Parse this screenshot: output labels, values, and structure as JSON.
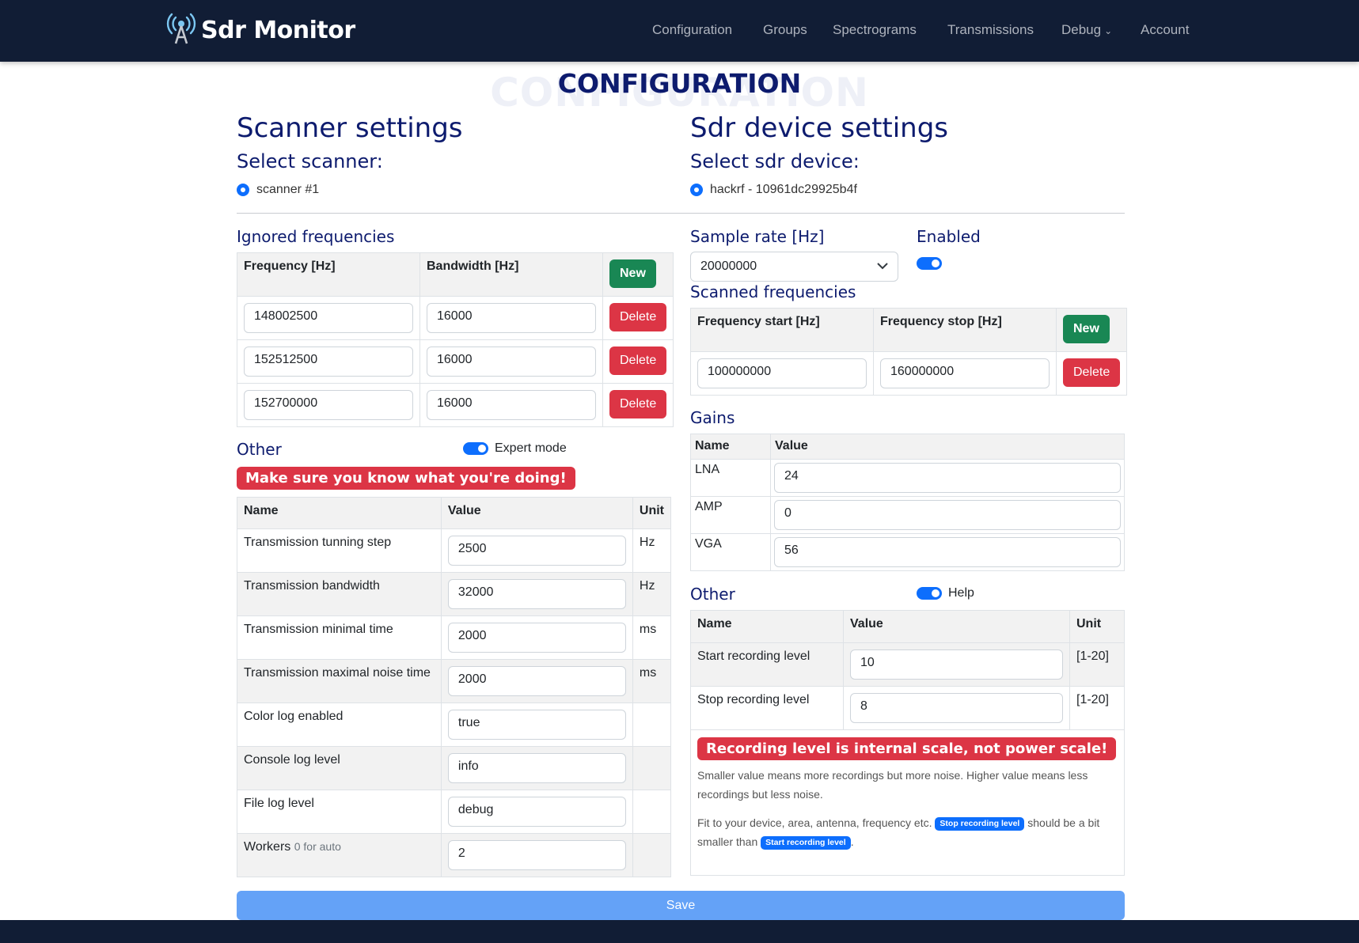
{
  "app": {
    "brand": "Sdr Monitor",
    "brand_icon": "antenna-icon"
  },
  "nav": {
    "configuration": "Configuration",
    "groups": "Groups",
    "spectrograms": "Spectrograms",
    "transmissions": "Transmissions",
    "debug": "Debug",
    "account": "Account"
  },
  "page": {
    "title": "CONFIGURATION"
  },
  "scanner": {
    "heading": "Scanner settings",
    "select_label": "Select scanner:",
    "selected": "scanner #1",
    "ignored": {
      "heading": "Ignored frequencies",
      "col_freq": "Frequency [Hz]",
      "col_bw": "Bandwidth [Hz]",
      "new": "New",
      "delete": "Delete",
      "rows": [
        {
          "freq": "148002500",
          "bw": "16000"
        },
        {
          "freq": "152512500",
          "bw": "16000"
        },
        {
          "freq": "152700000",
          "bw": "16000"
        }
      ]
    },
    "other": {
      "heading": "Other",
      "toggle_label": "Expert mode",
      "expert_on": true,
      "warning": "Make sure you know what you're doing!",
      "col_name": "Name",
      "col_value": "Value",
      "col_unit": "Unit",
      "rows": [
        {
          "name": "Transmission tunning step",
          "value": "2500",
          "unit": "Hz"
        },
        {
          "name": "Transmission bandwidth",
          "value": "32000",
          "unit": "Hz"
        },
        {
          "name": "Transmission minimal time",
          "value": "2000",
          "unit": "ms"
        },
        {
          "name": "Transmission maximal noise time",
          "value": "2000",
          "unit": "ms"
        },
        {
          "name": "Color log enabled",
          "value": "true",
          "unit": ""
        },
        {
          "name": "Console log level",
          "value": "info",
          "unit": ""
        },
        {
          "name": "File log level",
          "value": "debug",
          "unit": ""
        },
        {
          "name": "Workers",
          "hint": "0 for auto",
          "value": "2",
          "unit": ""
        }
      ]
    }
  },
  "sdr": {
    "heading": "Sdr device settings",
    "select_label": "Select sdr device:",
    "selected": "hackrf - 10961dc29925b4f",
    "sample_rate": {
      "label": "Sample rate [Hz]",
      "value": "20000000"
    },
    "enabled": {
      "label": "Enabled",
      "on": true
    },
    "scanned": {
      "heading": "Scanned frequencies",
      "col_start": "Frequency start [Hz]",
      "col_stop": "Frequency stop [Hz]",
      "new": "New",
      "delete": "Delete",
      "rows": [
        {
          "start": "100000000",
          "stop": "160000000"
        }
      ]
    },
    "gains": {
      "heading": "Gains",
      "col_name": "Name",
      "col_value": "Value",
      "rows": [
        {
          "name": "LNA",
          "value": "24"
        },
        {
          "name": "AMP",
          "value": "0"
        },
        {
          "name": "VGA",
          "value": "56"
        }
      ]
    },
    "other": {
      "heading": "Other",
      "toggle_label": "Help",
      "help_on": true,
      "col_name": "Name",
      "col_value": "Value",
      "col_unit": "Unit",
      "rows": [
        {
          "name": "Start recording level",
          "value": "10",
          "unit": "[1-20]"
        },
        {
          "name": "Stop recording level",
          "value": "8",
          "unit": "[1-20]"
        }
      ],
      "warning": "Recording level is internal scale, not power scale!",
      "help1": "Smaller value means more recordings but more noise. Higher value means less recordings but less noise.",
      "help2_a": "Fit to your device, area, antenna, frequency etc.",
      "help2_pill1": "Stop recording level",
      "help2_b": "should be a bit smaller than",
      "help2_pill2": "Start recording level",
      "help2_c": "."
    }
  },
  "save_label": "Save",
  "colors": {
    "navbar": "#111d35",
    "heading": "#0d1b6e",
    "primary": "#0d6efd",
    "success": "#198754",
    "danger": "#dc3545",
    "save": "#64a2f7"
  }
}
